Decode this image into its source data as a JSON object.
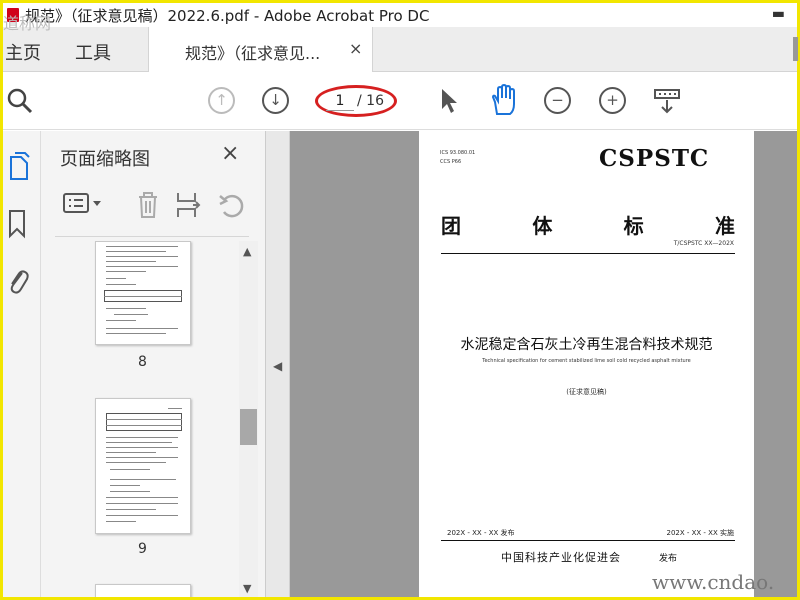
{
  "window": {
    "title": "规范》（征求意见稿）2022.6.pdf - Adobe Acrobat Pro DC",
    "minimize_icon": "minimize-icon"
  },
  "tabs": {
    "home": "主页",
    "tools": "工具",
    "document": "规范》（征求意见...",
    "close": "×"
  },
  "toolbar": {
    "search_icon": "search-icon",
    "prev_page_icon": "arrow-up-icon",
    "next_page_icon": "arrow-down-icon",
    "page_value": "1",
    "page_total": "/ 16",
    "select_icon": "pointer-icon",
    "hand_icon": "hand-icon",
    "zoom_out_icon": "minus-circle-icon",
    "zoom_in_icon": "plus-circle-icon",
    "scroll_mode_icon": "scroll-mode-icon"
  },
  "rail": {
    "items": [
      "pages-icon",
      "bookmark-icon",
      "attachment-icon"
    ]
  },
  "panel": {
    "heading": "页面缩略图",
    "close": "×",
    "tools": [
      "options-icon",
      "trash-icon",
      "insert-page-icon",
      "undo-icon"
    ],
    "thumbnails": [
      {
        "page": "8"
      },
      {
        "page": "9"
      }
    ]
  },
  "document": {
    "ics_line1": "ICS 93.080.01",
    "ics_line2": "CCS P66",
    "logo": "CSPSTC",
    "standard_chars": [
      "团",
      "体",
      "标",
      "准"
    ],
    "code": "T/CSPSTC XX—202X",
    "title": "水泥稳定含石灰土冷再生混合料技术规范",
    "subtitle": "Technical specification for cement stabilized lime soil cold recycled asphalt mixture",
    "draft": "(征求意见稿)",
    "issue_date": "202X - XX - XX 发布",
    "impl_date": "202X - XX - XX 实施",
    "publisher": "中国科技产业化促进会",
    "publisher_suffix": "发布"
  },
  "watermarks": {
    "top": "道称网",
    "bottom": "www.cndao."
  }
}
